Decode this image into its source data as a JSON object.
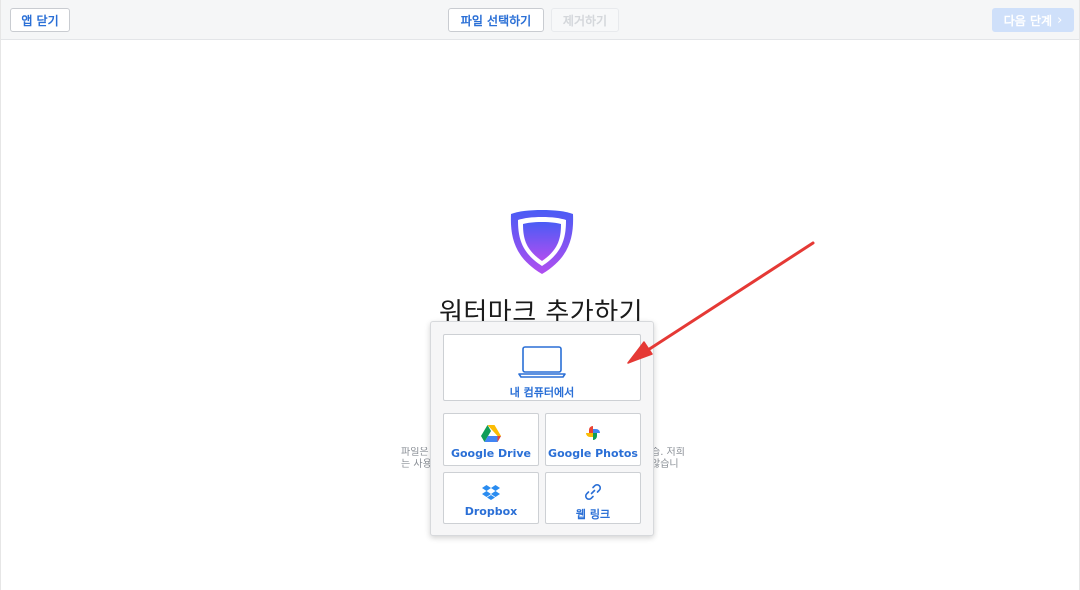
{
  "toolbar": {
    "close_label": "앱 닫기",
    "choose_file_label": "파일 선택하기",
    "remove_label": "제거하기",
    "next_label": "다음 단계",
    "next_icon": "chevron-right-icon",
    "next_disabled": true,
    "remove_disabled": true
  },
  "main": {
    "logo_icon": "shield-logo-icon",
    "title": "워터마크 추가하기",
    "note_left_line1": "파일은",
    "note_left_line2": "는 사용",
    "note_right_line1": "습. 저희",
    "note_right_line2": "않습니"
  },
  "upload_menu": {
    "computer": {
      "label": "내 컴퓨터에서",
      "icon": "laptop-icon"
    },
    "google_drive": {
      "label": "Google Drive",
      "icon": "google-drive-icon"
    },
    "google_photos": {
      "label": "Google Photos",
      "icon": "google-photos-icon"
    },
    "dropbox": {
      "label": "Dropbox",
      "icon": "dropbox-icon"
    },
    "web_link": {
      "label": "웹 링크",
      "icon": "link-icon"
    }
  },
  "annotation": {
    "arrow_icon": "red-arrow-icon",
    "arrow_color": "#e53935"
  },
  "colors": {
    "accent": "#2a6fd6",
    "shield_gradient_top": "#4a5cf5",
    "shield_gradient_bottom": "#b04ef0",
    "next_button_disabled": "#cfe0fa"
  }
}
